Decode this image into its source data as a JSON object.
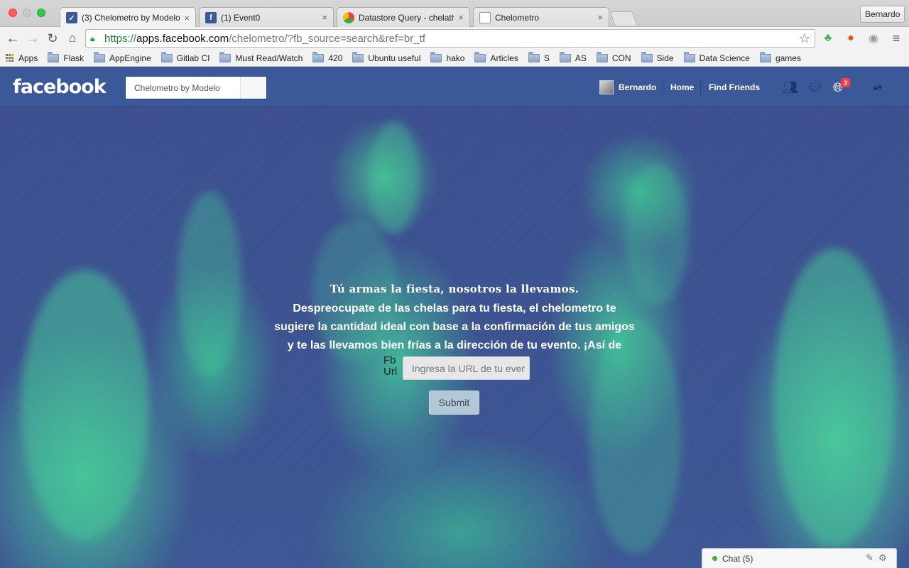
{
  "browser": {
    "tabs": [
      {
        "title": "(3) Chelometro by Modelo",
        "active": true
      },
      {
        "title": "(1) Event0",
        "active": false
      },
      {
        "title": "Datastore Query - chelatho",
        "active": false
      },
      {
        "title": "Chelometro",
        "active": false
      }
    ],
    "profile": "Bernardo",
    "url": {
      "scheme": "https://",
      "host": "apps.facebook.com",
      "path": "/chelometro/?fb_source=search&ref=br_tf"
    },
    "bookmarks": [
      "Apps",
      "Flask",
      "AppEngine",
      "Gitlab CI",
      "Must Read/Watch",
      "420",
      "Ubuntu useful",
      "hako",
      "Articles",
      "S",
      "AS",
      "CON",
      "Side",
      "Data Science",
      "games"
    ]
  },
  "facebook": {
    "logo": "facebook",
    "search_value": "Chelometro by Modelo",
    "user_name": "Bernardo",
    "nav_home": "Home",
    "nav_find_friends": "Find Friends",
    "notification_count": "3"
  },
  "hero": {
    "title": "Tú armas la fiesta, nosotros la llevamos.",
    "description": "Despreocupate de las chelas para tu fiesta, el chelometro te sugiere la cantidad ideal con base a la confirmación de tus amigos y te las llevamos bien frías a la dirección de tu evento. ¡Así de fácil!",
    "url_label": "Fb Url",
    "url_placeholder": "Ingresa la URL de tu ever",
    "submit_label": "Submit"
  },
  "chat": {
    "label": "Chat (5)"
  },
  "colors": {
    "facebook_blue": "#3b5998",
    "hero_green": "#46c498",
    "hero_blue": "#3b4f8e"
  }
}
